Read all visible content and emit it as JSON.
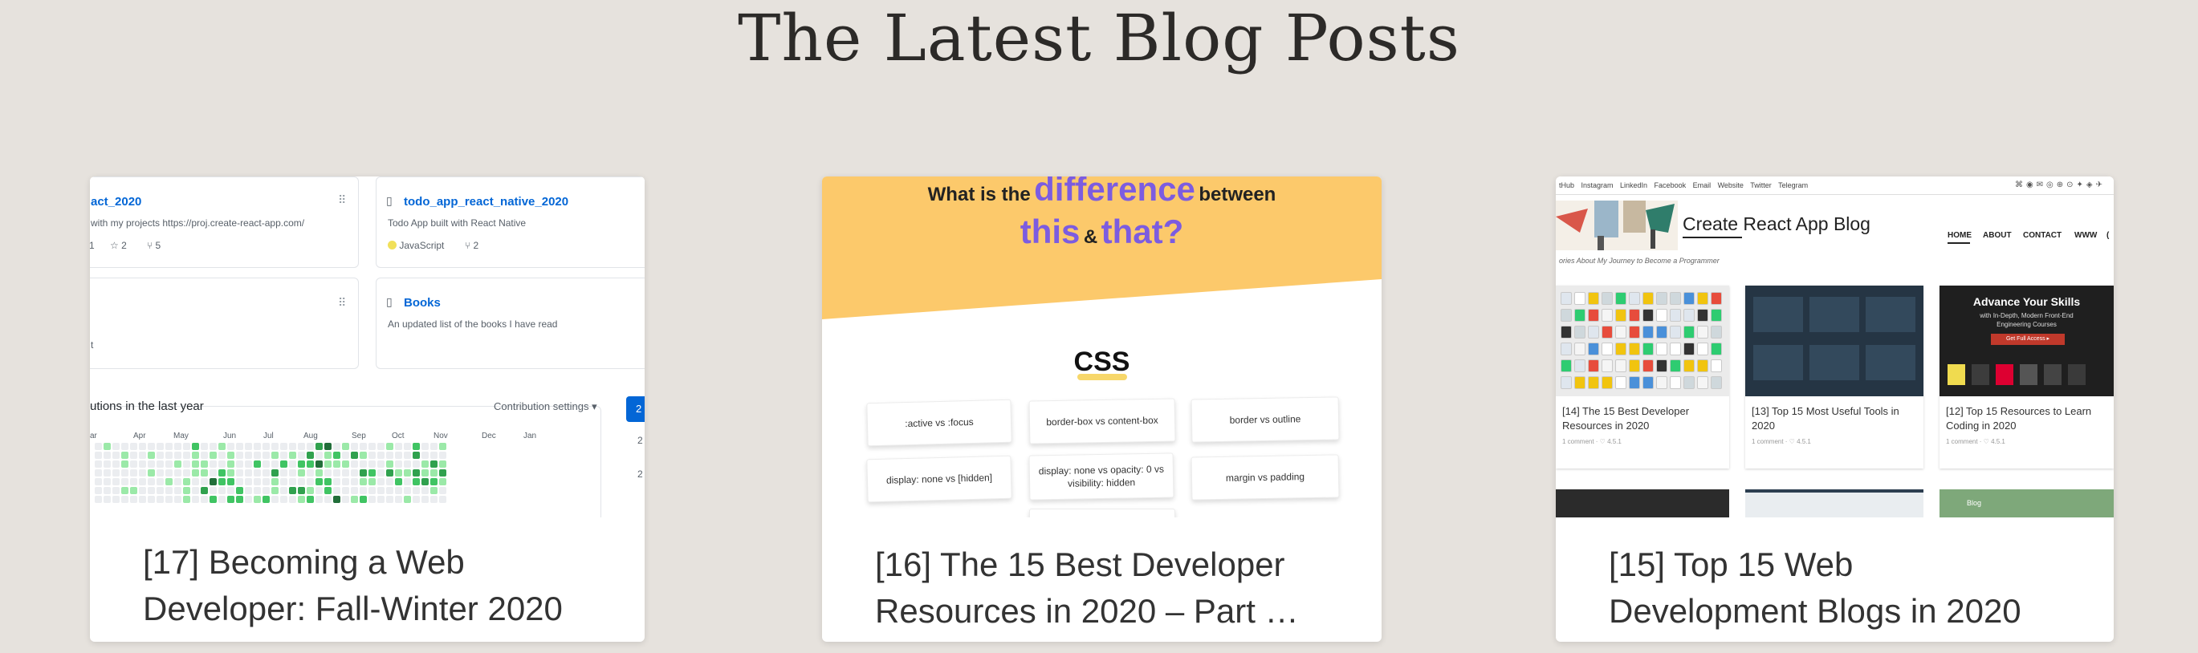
{
  "section": {
    "title": "The Latest Blog Posts"
  },
  "posts": [
    {
      "title": "[17] Becoming a Web Developer: Fall-Winter 2020",
      "thumb": {
        "repos": [
          {
            "name": "act_2020",
            "description": "with my projects https://proj.create-react-app.com/",
            "stars": "2",
            "forks": "5",
            "issues": "1"
          },
          {
            "name": "todo_app_react_native_2020",
            "description": "Todo App built with React Native",
            "language": "JavaScript",
            "forks": "2"
          },
          {
            "name": "",
            "description": "t"
          },
          {
            "name": "Books",
            "description": "An updated list of the books I have read"
          }
        ],
        "contrib_label": "utions in the last year",
        "contrib_settings": "Contribution settings ▾",
        "year_button": "2",
        "side_years": [
          "2",
          "2"
        ],
        "months": [
          "ar",
          "Apr",
          "May",
          "Jun",
          "Jul",
          "Aug",
          "Sep",
          "Oct",
          "Nov",
          "Dec",
          "Jan"
        ],
        "colors": {
          "link": "#0366d6",
          "js_dot": "#f1e05a",
          "accent": "#0366d6"
        }
      }
    },
    {
      "title_line1": "[16] The 15 Best Developer",
      "title_line2": "Resources in 2020 – Part …",
      "thumb": {
        "heading_pre": "What is the",
        "heading_big": "difference",
        "heading_post": "between",
        "heading_this": "this",
        "heading_amp": "&",
        "heading_that": "that?",
        "css_label": "CSS",
        "pills": [
          ":active vs :focus",
          "border-box vs content-box",
          "border vs outline",
          "display: none vs [hidden]",
          "display: none vs opacity: 0 vs visibility: hidden",
          "margin vs padding"
        ],
        "colors": {
          "band": "#fcc96b",
          "purple": "#7c5ce0",
          "underline": "#f7d76a"
        }
      }
    },
    {
      "title": "[15] Top 15 Web Development Blogs in 2020",
      "thumb": {
        "top_links": "tHub Instagram LinkedIn Facebook Email Website Twitter Telegram",
        "top_icons": "⌘◉✉◎⊕⊙✦◈✈",
        "blog_title": "Create React App Blog",
        "tagline": "ories About My Journey to Become a Programmer",
        "menu": [
          "HOME",
          "ABOUT",
          "CONTACT",
          "WWW",
          "("
        ],
        "tiles": [
          {
            "title": "[14] The 15 Best Developer Resources in 2020",
            "meta": "1 comment  ·  ♡ 4.5.1"
          },
          {
            "title": "[13] Top 15 Most Useful Tools in 2020",
            "meta": "1 comment  ·  ♡ 4.5.1"
          },
          {
            "title": "[12] Top 15 Resources to Learn Coding in 2020",
            "meta": "1 comment  ·  ♡ 4.5.1"
          }
        ],
        "ad_title": "Advance Your Skills",
        "ad_sub": "with In-Depth, Modern Front-End Engineering Courses",
        "ad_button": "Get Full Access ▸",
        "bottom_tile_label": "Blog"
      }
    }
  ]
}
